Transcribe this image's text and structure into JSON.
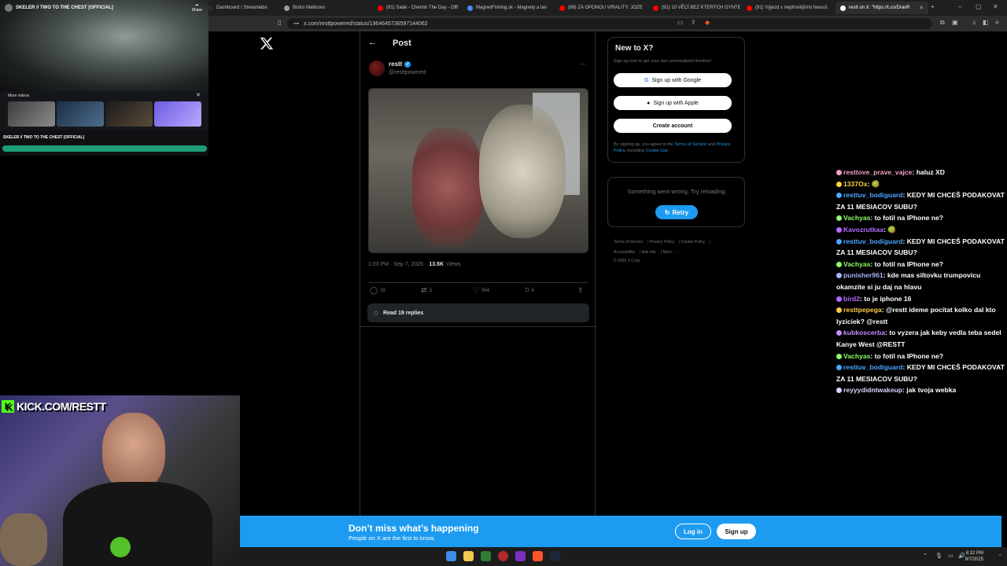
{
  "browser": {
    "tabs": [
      {
        "label": "Dashboard / Streamlabs",
        "color": "#2b2b2b",
        "active": false
      },
      {
        "label": "Bistro Malinovo",
        "color": "#9aa0a6",
        "active": false
      },
      {
        "label": "(91) Sade - Cherish The Day - Offi",
        "color": "#ff0000",
        "active": false
      },
      {
        "label": "MagnetFishing.sk - Magnety a lan",
        "color": "#4a8cf7",
        "active": false
      },
      {
        "label": "(89) ZA OPONOU VIRALITY: JOZE",
        "color": "#ff0000",
        "active": false
      },
      {
        "label": "(91) 10 VĚCÍ BEZ KTERÝCH GYNTE",
        "color": "#ff0000",
        "active": false
      },
      {
        "label": "(91) Výjezd s nejdrsnějšími fanouš",
        "color": "#ff0000",
        "active": false
      },
      {
        "label": "restt on X: \"https://t.co/DravR",
        "color": "#ffffff",
        "active": true
      }
    ],
    "url": "x.com/resttpowered/status/1964645736597144062"
  },
  "video": {
    "title": "SKELER // TWO TO THE CHEST [OFFICIAL]",
    "share_label": "Share",
    "more_videos_label": "More videos",
    "caption": "SKELER // TWO TO THE CHEST [OFFICIAL]",
    "progress": 1.0
  },
  "post": {
    "header_title": "Post",
    "author_name": "restt",
    "author_handle": "@resttpowered",
    "time": "1:03 PM · Sep 7, 2025 ·",
    "views_count": "13.5K",
    "views_label": "Views",
    "replies": "19",
    "reposts": "3",
    "likes": "564",
    "bookmarks": "6",
    "read_replies_label": "Read 19 replies"
  },
  "signup": {
    "title": "New to X?",
    "subtitle": "Sign up now to get your own personalized timeline!",
    "google_label": "Sign up with Google",
    "apple_label": "Sign up with Apple",
    "create_label": "Create account",
    "legal_prefix": "By signing up, you agree to the",
    "terms_link": "Terms of Service",
    "and_text": "and",
    "privacy_link": "Privacy Policy",
    "including_text": ", including",
    "cookie_link": "Cookie Use."
  },
  "error": {
    "message": "Something went wrong. Try reloading.",
    "retry_label": "Retry"
  },
  "footer": {
    "links": [
      "Terms of Service",
      "Privacy Policy",
      "Cookie Policy",
      "Accessibility",
      "Ads info",
      "More ···"
    ],
    "copyright": "© 2025 X Corp."
  },
  "chat": [
    {
      "user": "resttove_prave_vajce",
      "color": "#f5a0c8",
      "text": "haluz XD"
    },
    {
      "user": "1337Ox",
      "color": "#ffd23a",
      "text": "🥝"
    },
    {
      "user": "resttuv_bodiguard",
      "color": "#4aa8ff",
      "text": "KEDY MI CHCEŠ PODAKOVAT ZA 11 MESIACOV SUBU?"
    },
    {
      "user": "Vachyas",
      "color": "#8cff6a",
      "text": "to fotil na IPhone ne?"
    },
    {
      "user": "Kavozrutkaa",
      "color": "#b36bff",
      "text": "🥝"
    },
    {
      "user": "resttuv_bodiguard",
      "color": "#4aa8ff",
      "text": "KEDY MI CHCEŠ PODAKOVAT ZA 11 MESIACOV SUBU?"
    },
    {
      "user": "Vachyas",
      "color": "#8cff6a",
      "text": "to fotil na IPhone ne?"
    },
    {
      "user": "punisher961",
      "color": "#a9b4ff",
      "text": "kde mas siltovku trumpovicu okamzite si ju daj na hlavu"
    },
    {
      "user": "bird2",
      "color": "#b36bff",
      "text": "to je iphone 16"
    },
    {
      "user": "resttpepega",
      "color": "#ffc94a",
      "text": "@restt ideme pocitat kolko dal kto lyziciek? @restt"
    },
    {
      "user": "kubkoscerba",
      "color": "#c78bff",
      "text": "to vyzera jak keby vedla teba sedel Kanye West @RESTT"
    },
    {
      "user": "Vachyas",
      "color": "#8cff6a",
      "text": "to fotil na IPhone ne?"
    },
    {
      "user": "resttuv_bodiguard",
      "color": "#4aa8ff",
      "text": "KEDY MI CHCEŠ PODAKOVAT ZA 11 MESIACOV SUBU?"
    },
    {
      "user": "reyyydidntwakeup",
      "color": "#d7d7ff",
      "text": "jak tvoja webka"
    }
  ],
  "webcam": {
    "banner": "KICK.COM/RESTT"
  },
  "banner": {
    "title": "Don’t miss what’s happening",
    "subtitle": "People on X are the first to know.",
    "login_label": "Log in",
    "signup_label": "Sign up"
  },
  "taskbar": {
    "time": "8:32 PM",
    "date": "9/7/2025"
  }
}
